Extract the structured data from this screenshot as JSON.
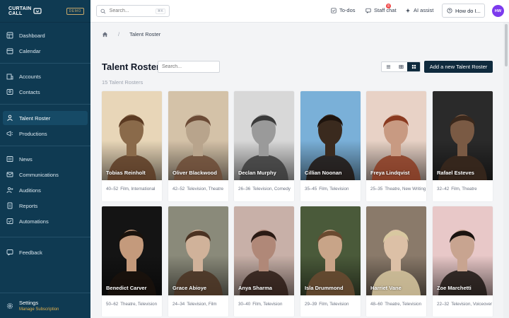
{
  "app": {
    "logo_text_line1": "CURTAIN",
    "logo_text_line2": "CALL",
    "demo_badge": "DEMO"
  },
  "sidebar": {
    "items": [
      {
        "label": "Dashboard",
        "icon": "dashboard-icon"
      },
      {
        "label": "Calendar",
        "icon": "calendar-icon"
      },
      {
        "label": "Accounts",
        "icon": "building-icon"
      },
      {
        "label": "Contacts",
        "icon": "contact-card-icon"
      },
      {
        "label": "Talent Roster",
        "icon": "person-icon",
        "active": true
      },
      {
        "label": "Productions",
        "icon": "megaphone-icon"
      },
      {
        "label": "News",
        "icon": "news-icon"
      },
      {
        "label": "Communications",
        "icon": "mail-icon"
      },
      {
        "label": "Auditions",
        "icon": "person-plus-icon"
      },
      {
        "label": "Reports",
        "icon": "report-icon"
      },
      {
        "label": "Automations",
        "icon": "automation-icon"
      },
      {
        "label": "Feedback",
        "icon": "feedback-icon"
      }
    ],
    "settings_label": "Settings",
    "settings_sub": "Manage Subscription"
  },
  "topbar": {
    "search_placeholder": "Search...",
    "search_shortcut": "⌘K",
    "todos_label": "To-dos",
    "staff_chat_label": "Staff chat",
    "staff_chat_count": "8",
    "ai_assist_label": "AI assist",
    "help_label": "How do I...",
    "avatar_initials": "HW"
  },
  "breadcrumb": {
    "current": "Talent Roster"
  },
  "page": {
    "title": "Talent Roster",
    "search_placeholder": "Search...",
    "count_text": "15 Talent Rosters",
    "add_button": "Add a new Talent Roster"
  },
  "talent": [
    {
      "name": "Tobias Reinholt",
      "age": "40–52",
      "tags": "Film, International",
      "palette": [
        "#8a6a4a",
        "#5b3a22",
        "#e8d6b8"
      ]
    },
    {
      "name": "Oliver Blackwood",
      "age": "42–52",
      "tags": "Television, Theatre",
      "palette": [
        "#b8a48c",
        "#6b4a35",
        "#d4c2a8"
      ]
    },
    {
      "name": "Declan Murphy",
      "age": "26–36",
      "tags": "Television, Comedy",
      "palette": [
        "#9a9a9a",
        "#3a3a3a",
        "#d8d8d8"
      ]
    },
    {
      "name": "Cillian Noonan",
      "age": "35–45",
      "tags": "Film, Television",
      "palette": [
        "#3a2a1e",
        "#1e140e",
        "#7ab0d8"
      ]
    },
    {
      "name": "Freya Lindqvist",
      "age": "25–35",
      "tags": "Theatre, New Writing",
      "palette": [
        "#c89a82",
        "#8a3a20",
        "#e8d2c6"
      ]
    },
    {
      "name": "Rafael Esteves",
      "age": "32–42",
      "tags": "Film, Theatre",
      "palette": [
        "#7a5a44",
        "#3a281c",
        "#2a2a2a"
      ]
    },
    {
      "name": "Benedict Carver",
      "age": "50–62",
      "tags": "Theatre, Television",
      "palette": [
        "#c49a7c",
        "#1a120c",
        "#141414"
      ]
    },
    {
      "name": "Grace Abioye",
      "age": "24–34",
      "tags": "Television, Film",
      "palette": [
        "#d0b29a",
        "#4a3222",
        "#8a8a7a"
      ]
    },
    {
      "name": "Anya Sharma",
      "age": "30–40",
      "tags": "Film, Television",
      "palette": [
        "#b08878",
        "#2a1a14",
        "#c8b0a8"
      ]
    },
    {
      "name": "Isla Drummond",
      "age": "29–39",
      "tags": "Film, Television",
      "palette": [
        "#c8a488",
        "#6a4a30",
        "#4a5a3a"
      ]
    },
    {
      "name": "Harriet Vane",
      "age": "48–60",
      "tags": "Theatre, Television",
      "palette": [
        "#dcc0a6",
        "#d8c8a0",
        "#8a7a6a"
      ]
    },
    {
      "name": "Zoe Marchetti",
      "age": "22–32",
      "tags": "Television, Voiceover",
      "palette": [
        "#c8a490",
        "#1a1410",
        "#e8c8c8"
      ]
    }
  ]
}
